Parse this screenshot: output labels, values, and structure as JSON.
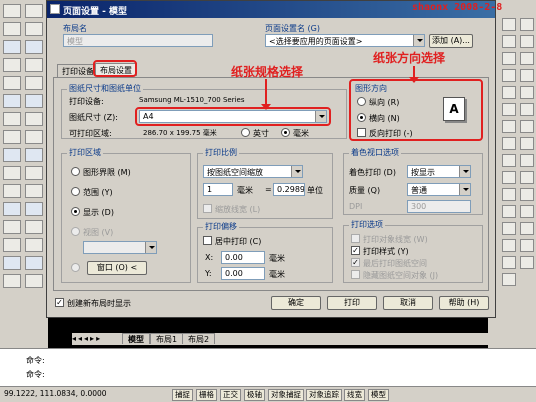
{
  "watermark": "shaonx 2008-2-8",
  "dialog": {
    "title": "页面设置 - 模型",
    "layout_name_label": "布局名",
    "layout_name_value": "模型",
    "page_setup_label": "页面设置名 (G)",
    "page_setup_value": "<选择要应用的页面设置>",
    "add_button": "添加 (A)...",
    "tabs": [
      "打印设备",
      "布局设置"
    ],
    "paper": {
      "group": "图纸尺寸和图纸单位",
      "device_label": "打印设备:",
      "device_value": "Samsung ML-1510_700 Series",
      "size_label": "图纸尺寸 (Z):",
      "size_value": "A4",
      "area_label": "可打印区域:",
      "area_value": "286.70 x 199.75 毫米",
      "unit_inch": "英寸",
      "unit_mm": "毫米"
    },
    "orientation": {
      "group": "图形方向",
      "portrait": "纵向 (R)",
      "landscape": "横向 (N)",
      "reverse": "反向打印 (-)",
      "paper_icon_letter": "A"
    },
    "print_area": {
      "group": "打印区域",
      "limits": "图形界限 (M)",
      "extents": "范围 (Y)",
      "display": "显示 (D)",
      "view": "视图 (V)",
      "window_button": "窗口 (O) <"
    },
    "print_scale": {
      "group": "打印比例",
      "scale_value": "按图纸空间缩放",
      "num1": "1",
      "unit1": "毫米",
      "eq": "=",
      "num2": "0.2989",
      "unit2": "单位",
      "lineweights": "缩放线宽 (L)"
    },
    "print_offset": {
      "group": "打印偏移",
      "center": "居中打印 (C)",
      "x_label": "X:",
      "x_value": "0.00",
      "x_unit": "毫米",
      "y_label": "Y:",
      "y_value": "0.00",
      "y_unit": "毫米"
    },
    "shade": {
      "group": "着色视口选项",
      "shade_plot_label": "着色打印 (D)",
      "shade_plot_value": "按显示",
      "quality_label": "质量 (Q)",
      "quality_value": "普通",
      "dpi_label": "DPI",
      "dpi_value": "300"
    },
    "plot_options": {
      "group": "打印选项",
      "lineweights": "打印对象线宽 (W)",
      "plot_styles": "打印样式 (Y)",
      "paperspace_last": "最后打印图纸空间",
      "hide_paperspace": "隐藏图纸空间对象 (J)"
    },
    "new_layout_check": "创建新布局时显示",
    "ok": "确定",
    "print": "打印",
    "cancel": "取消",
    "help": "帮助 (H)"
  },
  "annotations": {
    "paper_size": "纸张规格选择",
    "orientation": "纸张方向选择"
  },
  "layout_tabs": [
    "模型",
    "布局1",
    "布局2"
  ],
  "command": {
    "line1": "命令:",
    "line2": "命令:"
  },
  "status_bar": {
    "coords": "99.1222, 111.0834, 0.0000",
    "items": [
      "捕捉",
      "栅格",
      "正交",
      "极轴",
      "对象捕捉",
      "对象追踪",
      "线宽",
      "模型"
    ]
  },
  "colors": {
    "accent_red": "#e02020",
    "title_blue": "#0a246a"
  }
}
